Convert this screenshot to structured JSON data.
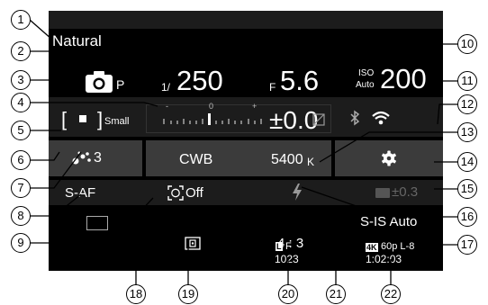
{
  "callouts": [
    "1",
    "2",
    "3",
    "4",
    "5",
    "6",
    "7",
    "8",
    "9",
    "10",
    "11",
    "12",
    "13",
    "14",
    "15",
    "16",
    "17",
    "18",
    "19",
    "20",
    "21",
    "22"
  ],
  "picture_mode": "Natural",
  "shutter": {
    "prefix": "1/",
    "value": "250"
  },
  "aperture": {
    "prefix": "F",
    "value": "5.6"
  },
  "iso": {
    "top": "ISO",
    "bottom": "Auto",
    "value": "200"
  },
  "shooting_mode": {
    "icon": "camera-icon",
    "letter": "P"
  },
  "exposure": {
    "value": "±0.0",
    "scale_zero": "0",
    "scale_minus": "-",
    "scale_plus": "+"
  },
  "image_size": {
    "label": "Small"
  },
  "connectivity": {
    "icons": [
      "bluetooth-icon",
      "wifi-icon"
    ]
  },
  "picture_style": {
    "value": "3"
  },
  "wb": {
    "label": "CWB",
    "value": "5400",
    "unit": "K"
  },
  "settings": {
    "icon": "gear-icon"
  },
  "focus_mode": "S-AF",
  "face_priority": {
    "value": "Off"
  },
  "flash": {
    "icon": "flash-icon"
  },
  "flash_comp": {
    "value": "±0.3"
  },
  "stabilizer": "S-IS Auto",
  "aspect": "4 : 3",
  "quality": {
    "badge": "L",
    "label": "F",
    "count": "1023"
  },
  "video": {
    "badge": "4K",
    "spec": "60p L-8",
    "time": "1:02:03"
  },
  "colors": {
    "bg": "#000000",
    "row_shade": "#1c1c1c",
    "highlight": "#3b3b3b",
    "text": "#ffffff",
    "dim": "#777777"
  }
}
